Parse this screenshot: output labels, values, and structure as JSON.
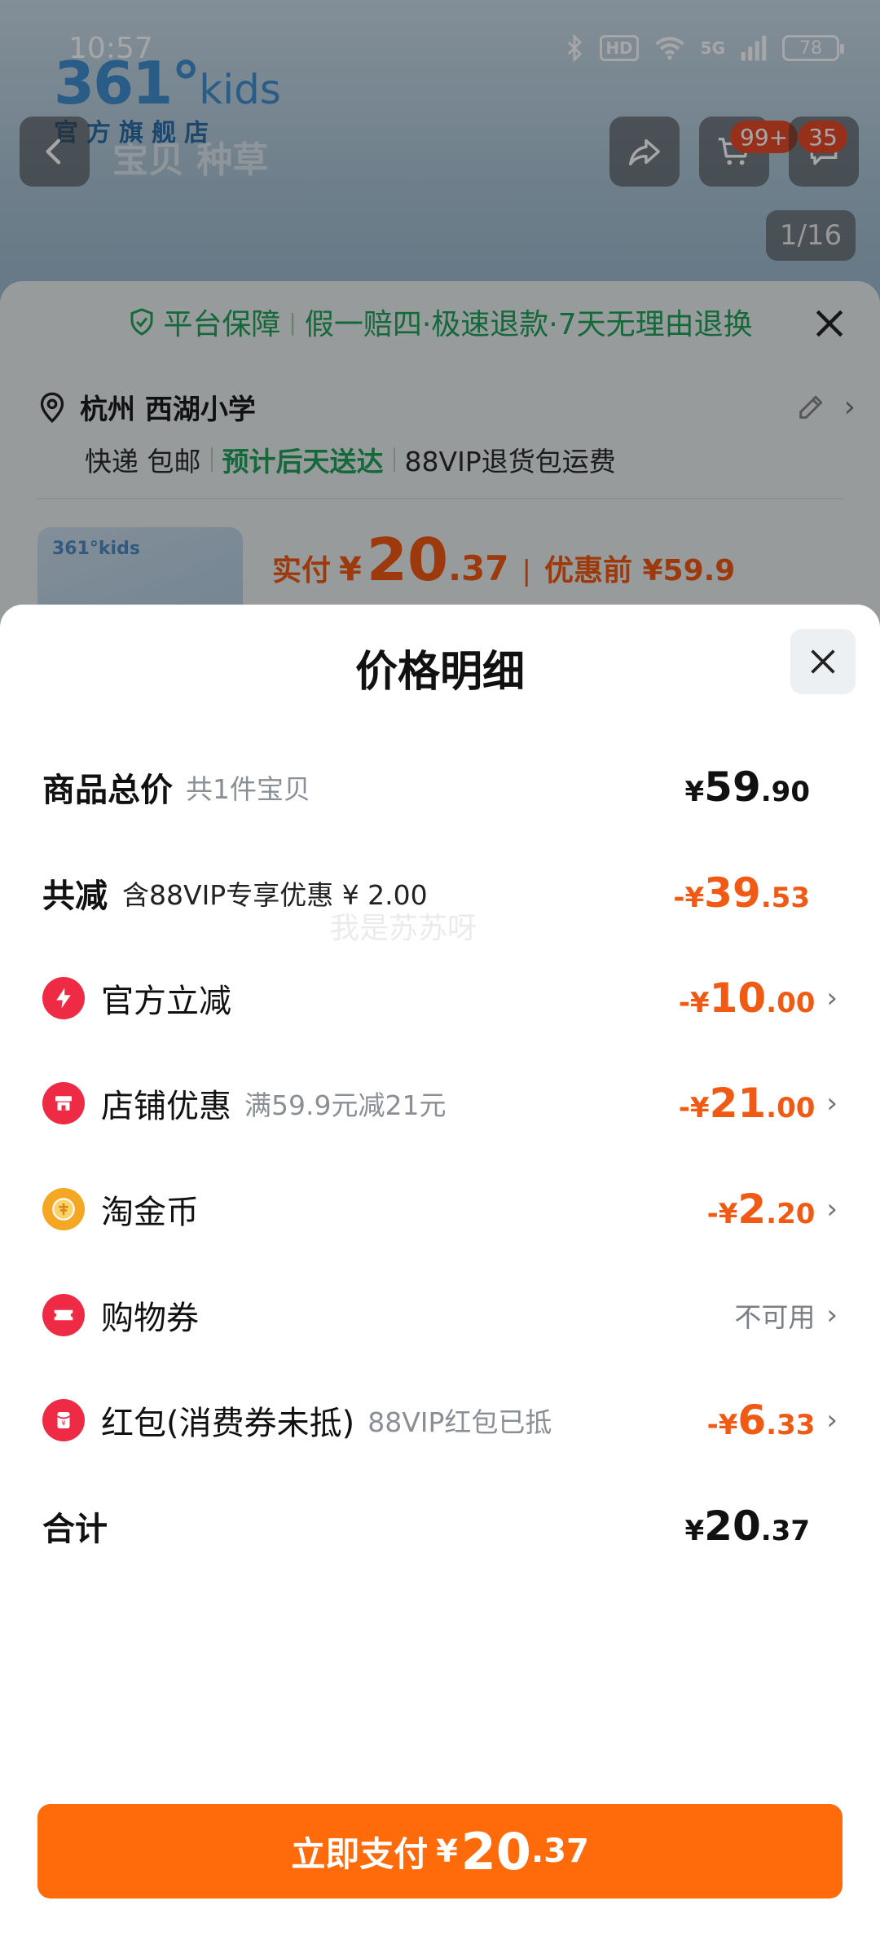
{
  "status_bar": {
    "time": "10:57",
    "hd": "HD",
    "network": "5G",
    "battery": "78"
  },
  "background": {
    "logo_text": "361°",
    "logo_kids": "kids",
    "logo_sub": "官方旗舰店",
    "nav_tabs": "宝贝 种草",
    "cart_badge": "99+",
    "msg_badge": "35",
    "image_counter": "1/16"
  },
  "order_sheet": {
    "guarantee_title": "平台保障",
    "guarantee_text": "假一赔四·极速退款·7天无理由退换",
    "address": "杭州 西湖小学",
    "shipping_method": "快递 包邮",
    "delivery_estimate": "预计后天送达",
    "return_note": "88VIP退货包运费",
    "thumb_text": "361°kids",
    "paid_label": "实付",
    "paid_currency": "¥",
    "paid_int": "20",
    "paid_dec": ".37",
    "separator": "|",
    "before_discount": "优惠前 ¥59.9"
  },
  "price_detail": {
    "title": "价格明细",
    "watermark": "我是苏苏呀",
    "rows": [
      {
        "label": "商品总价",
        "note": "共1件宝贝",
        "currency": "¥",
        "int": "59",
        "dec": ".90"
      },
      {
        "label": "共减",
        "note": "含88VIP专享优惠 ¥ 2.00",
        "currency": "-¥",
        "int": "39",
        "dec": ".53"
      },
      {
        "label": "官方立减",
        "note": "",
        "currency": "-¥",
        "int": "10",
        "dec": ".00"
      },
      {
        "label": "店铺优惠",
        "note": "满59.9元减21元",
        "currency": "-¥",
        "int": "21",
        "dec": ".00"
      },
      {
        "label": "淘金币",
        "note": "",
        "currency": "-¥",
        "int": "2",
        "dec": ".20"
      },
      {
        "label": "购物券",
        "note": "",
        "value_text": "不可用"
      },
      {
        "label": "红包(消费券未抵)",
        "note": "88VIP红包已抵",
        "currency": "-¥",
        "int": "6",
        "dec": ".33"
      },
      {
        "label": "合计",
        "note": "",
        "currency": "¥",
        "int": "20",
        "dec": ".37"
      }
    ],
    "icons": [
      "lightning-icon",
      "shop-icon",
      "gold-coin-icon",
      "ticket-icon",
      "red-packet-icon"
    ]
  },
  "pay_button": {
    "label": "立即支付",
    "currency": "¥",
    "int": "20",
    "dec": ".37"
  },
  "colors": {
    "accent": "#ff6a0a",
    "discount": "#f05a14",
    "icon_red": "#ee2a45",
    "coin": "#f5a623",
    "guarantee_green": "#1fa05a"
  }
}
